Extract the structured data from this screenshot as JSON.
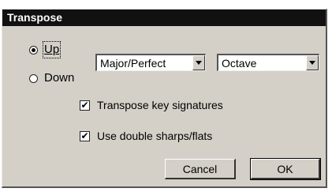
{
  "window": {
    "title": "Transpose"
  },
  "direction": {
    "up_label": "Up",
    "down_label": "Down",
    "selected": "up"
  },
  "interval": {
    "quality": "Major/Perfect",
    "size": "Octave"
  },
  "options": {
    "transpose_key_signatures_label": "Transpose key signatures",
    "transpose_key_signatures_checked": true,
    "use_double_sharps_label": "Use double sharps/flats",
    "use_double_sharps_checked": true
  },
  "buttons": {
    "cancel_label": "Cancel",
    "ok_label": "OK"
  },
  "icons": {
    "dropdown": "chevron-down-icon",
    "check": "checkmark-icon"
  }
}
